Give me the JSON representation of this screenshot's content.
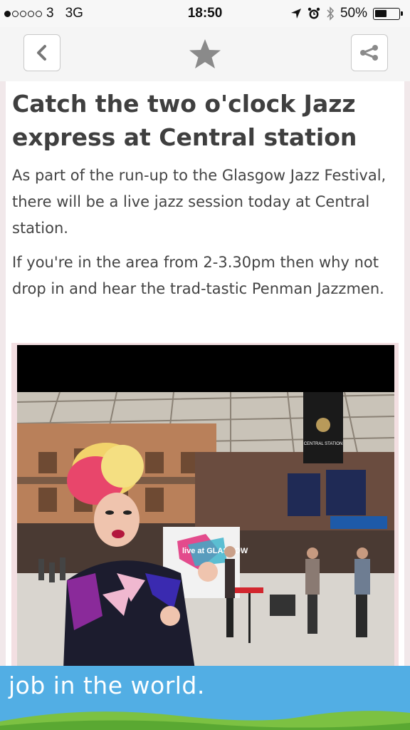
{
  "status_bar": {
    "signal_dots_filled": 1,
    "signal_dots_total": 5,
    "carrier": "3",
    "network": "3G",
    "time": "18:50",
    "battery_percent": "50%",
    "battery_level": 0.5
  },
  "navbar": {
    "back_icon": "chevron-left-icon",
    "favorite_icon": "star-icon",
    "share_icon": "share-icon"
  },
  "article": {
    "title": "Catch the two o'clock Jazz express at Central station",
    "paragraphs": [
      "As part of the run-up to the Glasgow Jazz Festival, there will be a live jazz session today at Central station.",
      "If you're in the area from 2-3.30pm then why not drop in and hear the trad-tastic Penman Jazzmen."
    ],
    "photo": {
      "sign_text": "CENTRAL STATION",
      "banner_text": "live at GLASGOW"
    }
  },
  "banner": {
    "text": "job in the world."
  },
  "colors": {
    "banner_blue": "#52aee4",
    "banner_green": "#7cc142",
    "title": "#3f3f3f"
  }
}
